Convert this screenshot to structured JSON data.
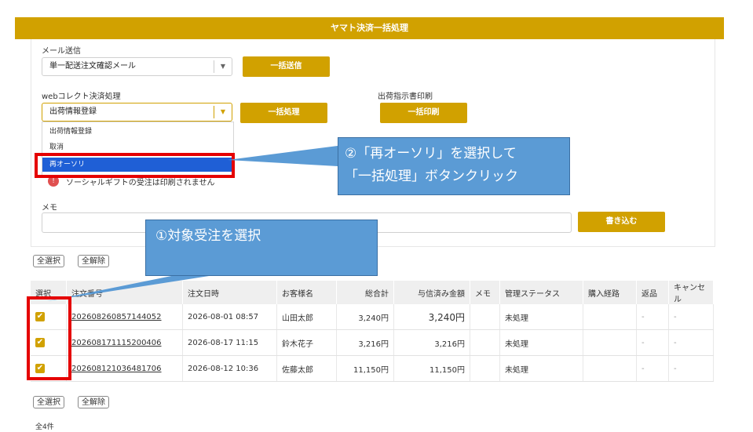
{
  "header": {
    "title": "ヤマト決済一括処理"
  },
  "mail": {
    "label": "メール送信",
    "select_value": "単一配送注文確認メール",
    "send_button": "一括送信"
  },
  "webcollect": {
    "label": "webコレクト決済処理",
    "select_value": "出荷情報登録",
    "process_button": "一括処理",
    "dropdown_options": [
      "出荷情報登録",
      "取消",
      "再オーソリ"
    ]
  },
  "shipping": {
    "label": "出荷指示書印刷",
    "print_button": "一括印刷"
  },
  "warning_text": "ソーシャルギフトの受注は印刷されません",
  "memo": {
    "label": "メモ",
    "write_button": "書き込む"
  },
  "callout1": {
    "line1": "②「再オーソリ」を選択して",
    "line2": "「一括処理」ボタンクリック"
  },
  "callout2": {
    "text": "①対象受注を選択"
  },
  "selection": {
    "select_all": "全選択",
    "deselect_all": "全解除"
  },
  "table": {
    "columns": [
      "選択",
      "注文番号",
      "注文日時",
      "お客様名",
      "総合計",
      "与信済み金額",
      "メモ",
      "管理ステータス",
      "購入経路",
      "返品",
      "キャンセル"
    ],
    "rows": [
      {
        "checked": "✔",
        "order_no": "202608260857144052",
        "date": "2026-08-01 08:57",
        "customer": "山田太郎",
        "total": "3,240円",
        "credit": "3,240円",
        "memo": "",
        "status": "未処理",
        "route": "",
        "returned": "-",
        "cancel": "-"
      },
      {
        "checked": "✔",
        "order_no": "202608171115200406",
        "date": "2026-08-17 11:15",
        "customer": "鈴木花子",
        "total": "3,216円",
        "credit": "3,216円",
        "memo": "",
        "status": "未処理",
        "route": "",
        "returned": "-",
        "cancel": "-"
      },
      {
        "checked": "✔",
        "order_no": "202608121036481706",
        "date": "2026-08-12 10:36",
        "customer": "佐藤太郎",
        "total": "11,150円",
        "credit": "11,150円",
        "memo": "",
        "status": "未処理",
        "route": "",
        "returned": "-",
        "cancel": "-"
      }
    ]
  },
  "footer": {
    "count": "全4件"
  },
  "colors": {
    "accent": "#d1a100",
    "highlight": "#e50000",
    "callout": "#5b9bd5",
    "selected_option": "#1f5fd6"
  }
}
